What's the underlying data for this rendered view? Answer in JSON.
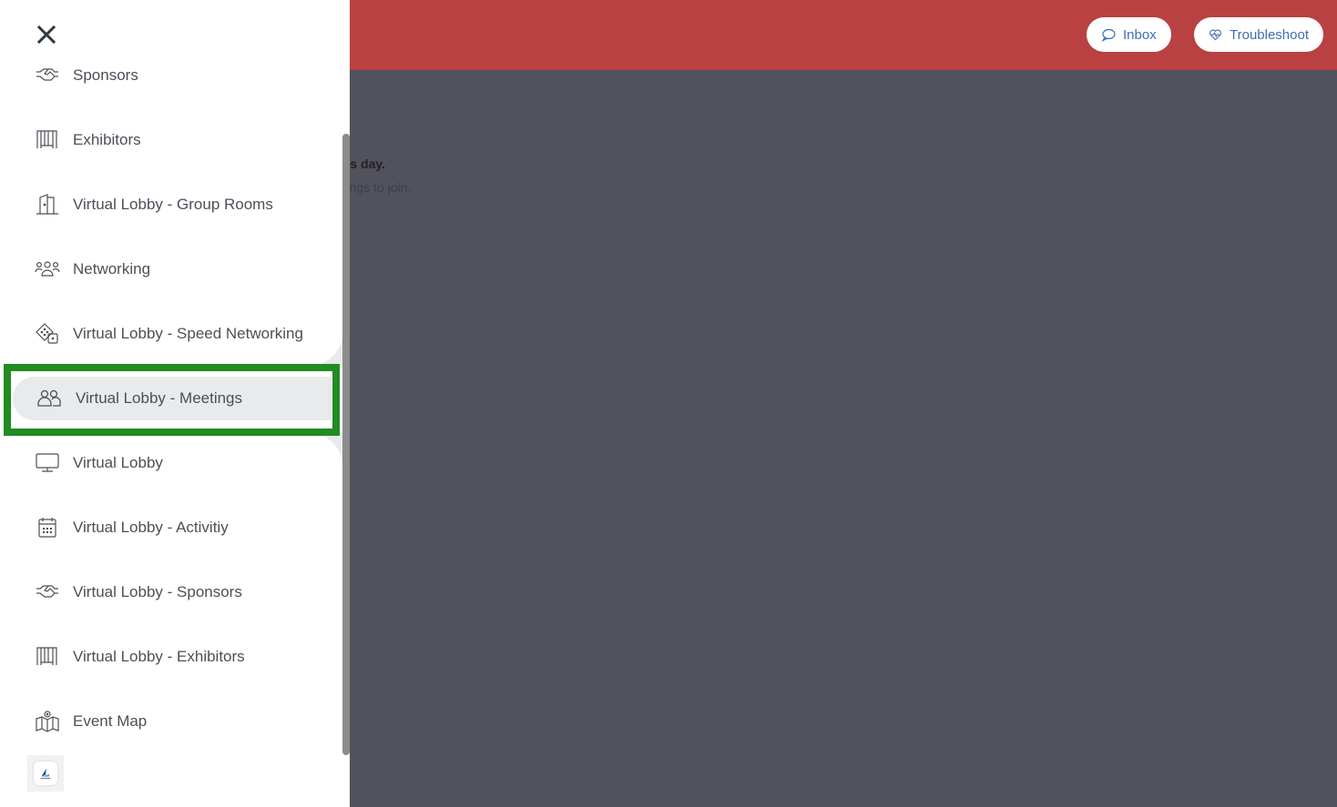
{
  "header": {
    "background_color": "#b94141",
    "buttons": {
      "inbox_label": "Inbox",
      "troubleshoot_label": "Troubleshoot"
    },
    "button_text_color": "#3b6fb6"
  },
  "main": {
    "message_title": "s available for this day.",
    "message_subtitle": "en there are meetings to join."
  },
  "drawer": {
    "close_icon": "close-icon",
    "items": [
      {
        "label": "Sponsors",
        "icon": "handshake-icon"
      },
      {
        "label": "Exhibitors",
        "icon": "booth-icon"
      },
      {
        "label": "Virtual Lobby - Group Rooms",
        "icon": "door-icon"
      },
      {
        "label": "Networking",
        "icon": "people-group-icon"
      },
      {
        "label": "Virtual Lobby - Speed Networking",
        "icon": "dice-icon"
      },
      {
        "label": "Virtual Lobby - Meetings",
        "icon": "users-icon",
        "active": true
      },
      {
        "label": "Virtual Lobby",
        "icon": "monitor-icon"
      },
      {
        "label": "Virtual Lobby - Activitiy",
        "icon": "calendar-icon"
      },
      {
        "label": "Virtual Lobby - Sponsors",
        "icon": "handshake-icon"
      },
      {
        "label": "Virtual Lobby - Exhibitors",
        "icon": "booth-icon"
      },
      {
        "label": "Event Map",
        "icon": "map-icon"
      }
    ],
    "highlight_color": "#228b22",
    "active_bg_color": "#e8eaeb"
  }
}
